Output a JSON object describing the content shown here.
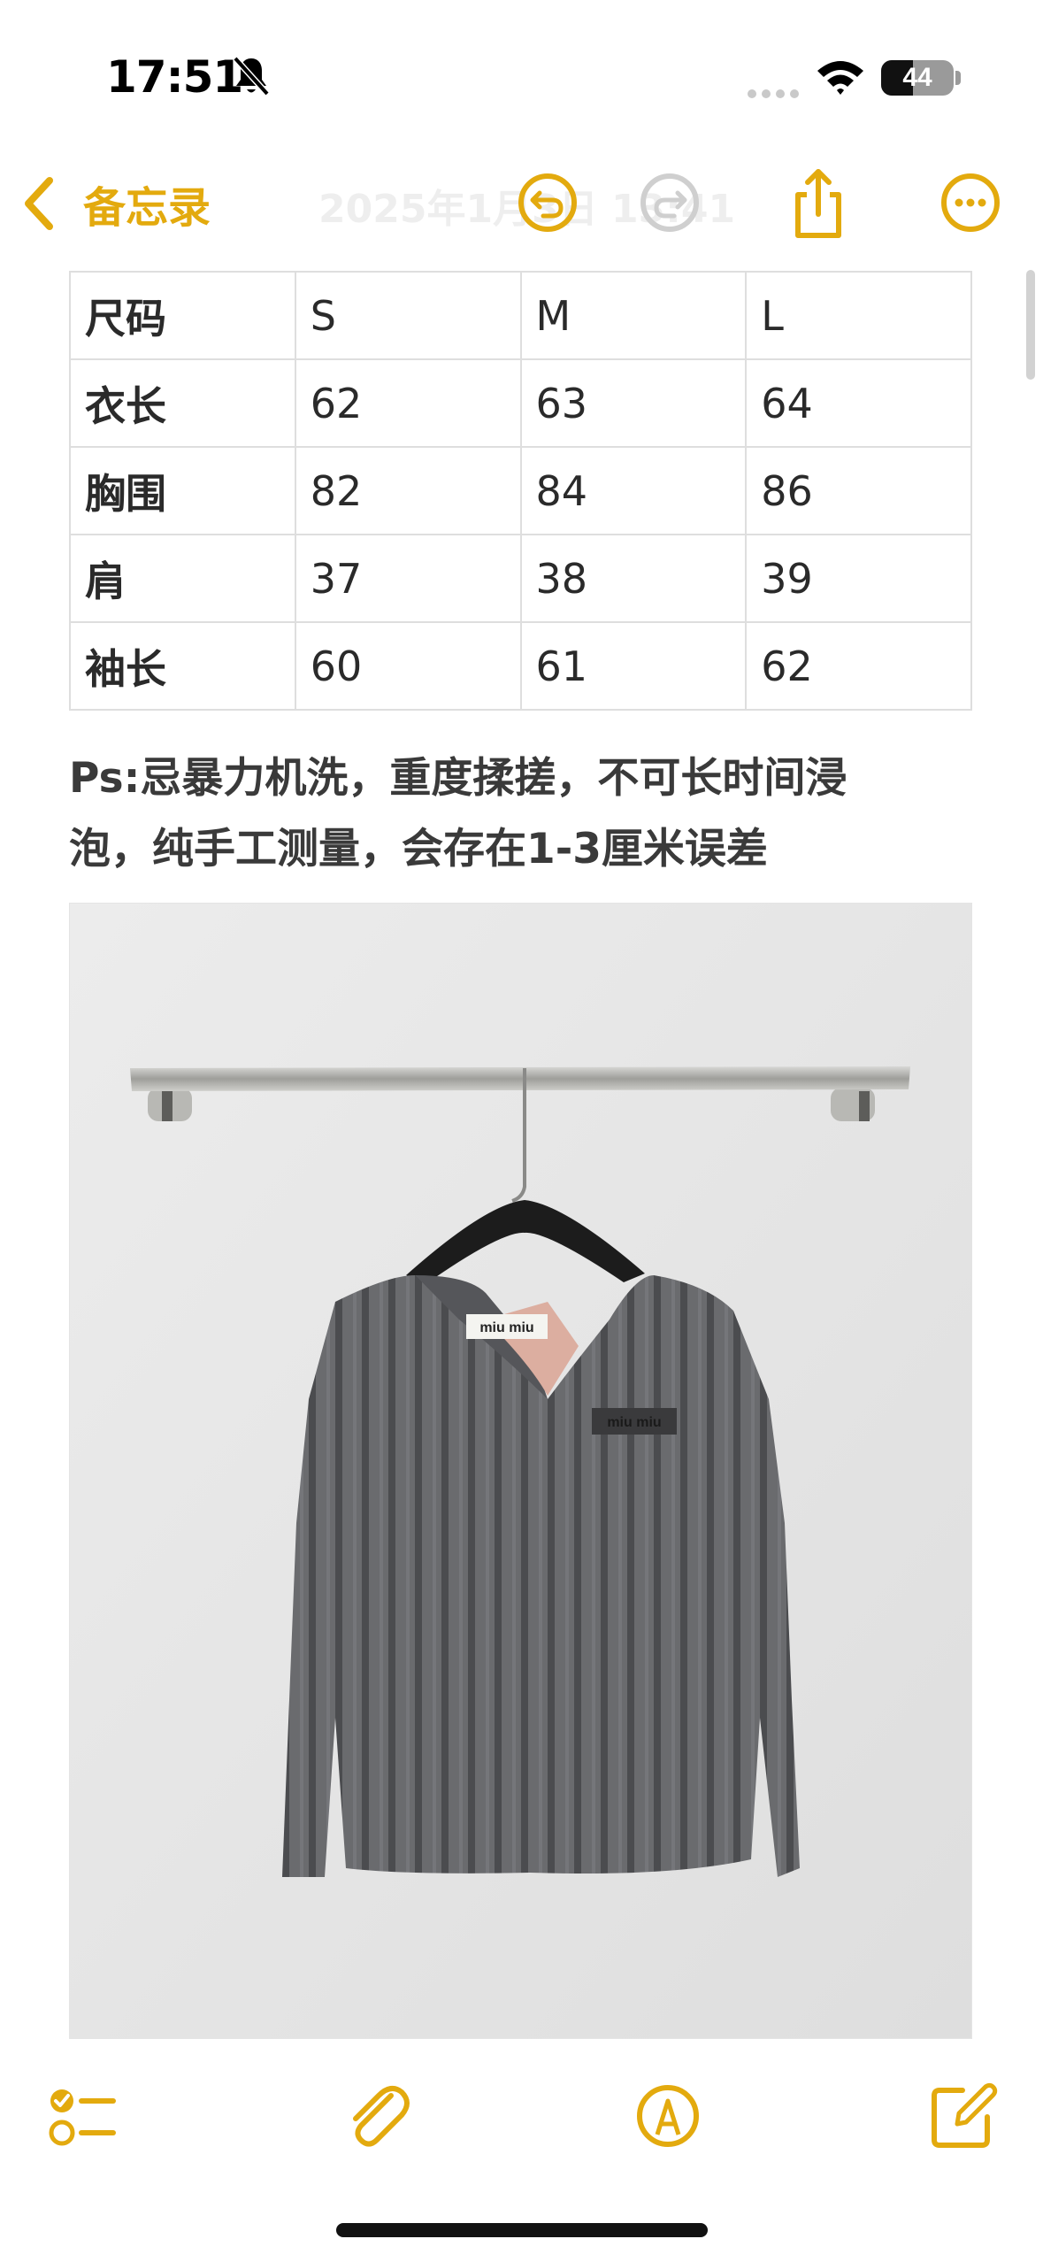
{
  "status": {
    "time": "17:51",
    "battery": "44",
    "battery_fraction": 0.44,
    "icons": [
      "bell-slash-icon",
      "cellular-signal-icon",
      "wifi-icon",
      "battery-icon"
    ]
  },
  "nav": {
    "back_label": "备忘录",
    "faded_title": "2025年1月3日 13:41",
    "icons": [
      "chevron-left-icon",
      "undo-icon",
      "redo-icon",
      "share-icon",
      "more-icon"
    ]
  },
  "table": {
    "header": [
      "尺码",
      "S",
      "M",
      "L"
    ],
    "rows": [
      [
        "衣长",
        "62",
        "63",
        "64"
      ],
      [
        "胸围",
        "82",
        "84",
        "86"
      ],
      [
        "肩",
        "37",
        "38",
        "39"
      ],
      [
        "袖长",
        "60",
        "61",
        "62"
      ]
    ]
  },
  "note": {
    "line1": "Ps:忌暴力机洗，重度揉搓，不可长时间浸",
    "line2": "泡，纯手工测量，会存在1-3厘米误差"
  },
  "photo": {
    "label_text": "miu miu",
    "badge_text": "miu miu"
  },
  "toolbar": {
    "icons": [
      "checklist-icon",
      "paperclip-icon",
      "markup-pen-icon",
      "compose-icon"
    ]
  },
  "colors": {
    "accent": "#e3aa0e",
    "table_border": "#dedede",
    "text": "#2a2a2a",
    "sweater": "#5f6063"
  }
}
